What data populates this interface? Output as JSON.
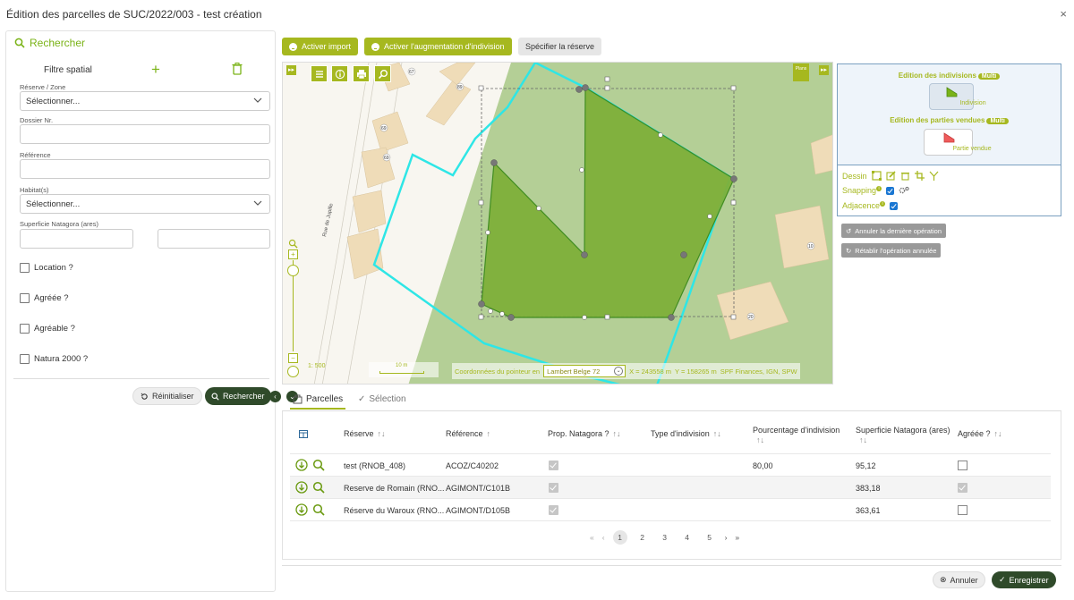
{
  "modal": {
    "title": "Édition des parcelles de SUC/2022/003 - test création",
    "close": "×"
  },
  "left": {
    "search_title": "Rechercher",
    "spatial_filter": "Filtre spatial",
    "reserve_label": "Réserve / Zone",
    "reserve_value": "Sélectionner...",
    "dossier_label": "Dossier Nr.",
    "reference_label": "Référence",
    "habitat_label": "Habitat(s)",
    "habitat_value": "Sélectionner...",
    "superficie_label": "Superficie Natagora (ares)",
    "checkboxes": [
      "Location ?",
      "Agréée ?",
      "Agréable ?",
      "Natura 2000 ?"
    ],
    "reset": "Réinitialiser",
    "search": "Rechercher"
  },
  "toolbar": {
    "import": "Activer import",
    "augment": "Activer l'augmentation d'indivision",
    "reserve": "Spécifier la réserve"
  },
  "map": {
    "street": "Rue de Jupille",
    "scale": "1: 500",
    "scalebar": "10 m",
    "coord_label": "Coordonnées du pointeur en",
    "projection": "Lambert Belge 72",
    "x": "X = 243558 m",
    "y": "Y = 158265 m",
    "attribution": "SPF Finances, IGN, SPW",
    "plans": "Plans",
    "house_numbers": [
      "67",
      "89",
      "69",
      "69",
      "10",
      "20"
    ]
  },
  "edit": {
    "indivisions_title": "Edition des indivisions",
    "multi": "Multi",
    "indivision": "Indivision",
    "vendues_title": "Edition des parties vendues",
    "partie_vendue": "Partie vendue",
    "dessin": "Dessin",
    "snapping": "Snapping",
    "adjacence": "Adjacence",
    "undo": "Annuler la dernière opération",
    "redo": "Rétablir l'opération annulée"
  },
  "tabs": {
    "parcelles": "Parcelles",
    "selection": "Sélection"
  },
  "table": {
    "headers": {
      "reserve": "Réserve",
      "reference": "Référence",
      "prop": "Prop. Natagora ?",
      "type": "Type d'indivision",
      "pourcentage": "Pourcentage d'indivision",
      "superficie": "Superficie Natagora (ares)",
      "agreee": "Agréée ?"
    },
    "rows": [
      {
        "reserve": "test (RNOB_408)",
        "reference": "ACOZ/C40202",
        "type": "",
        "pourcentage": "80,00",
        "superficie": "95,12",
        "prop": true,
        "agreee": false
      },
      {
        "reserve": "Reserve de Romain (RNO...",
        "reference": "AGIMONT/C101B",
        "type": "",
        "pourcentage": "",
        "superficie": "383,18",
        "prop": true,
        "agreee": true
      },
      {
        "reserve": "Réserve du Waroux (RNO...",
        "reference": "AGIMONT/D105B",
        "type": "",
        "pourcentage": "",
        "superficie": "363,61",
        "prop": true,
        "agreee": false
      }
    ],
    "pager": {
      "first": "«",
      "prev": "‹",
      "pages": [
        "1",
        "2",
        "3",
        "4",
        "5"
      ],
      "next": "›",
      "last": "»"
    }
  },
  "footer": {
    "cancel": "Annuler",
    "save": "Enregistrer"
  }
}
